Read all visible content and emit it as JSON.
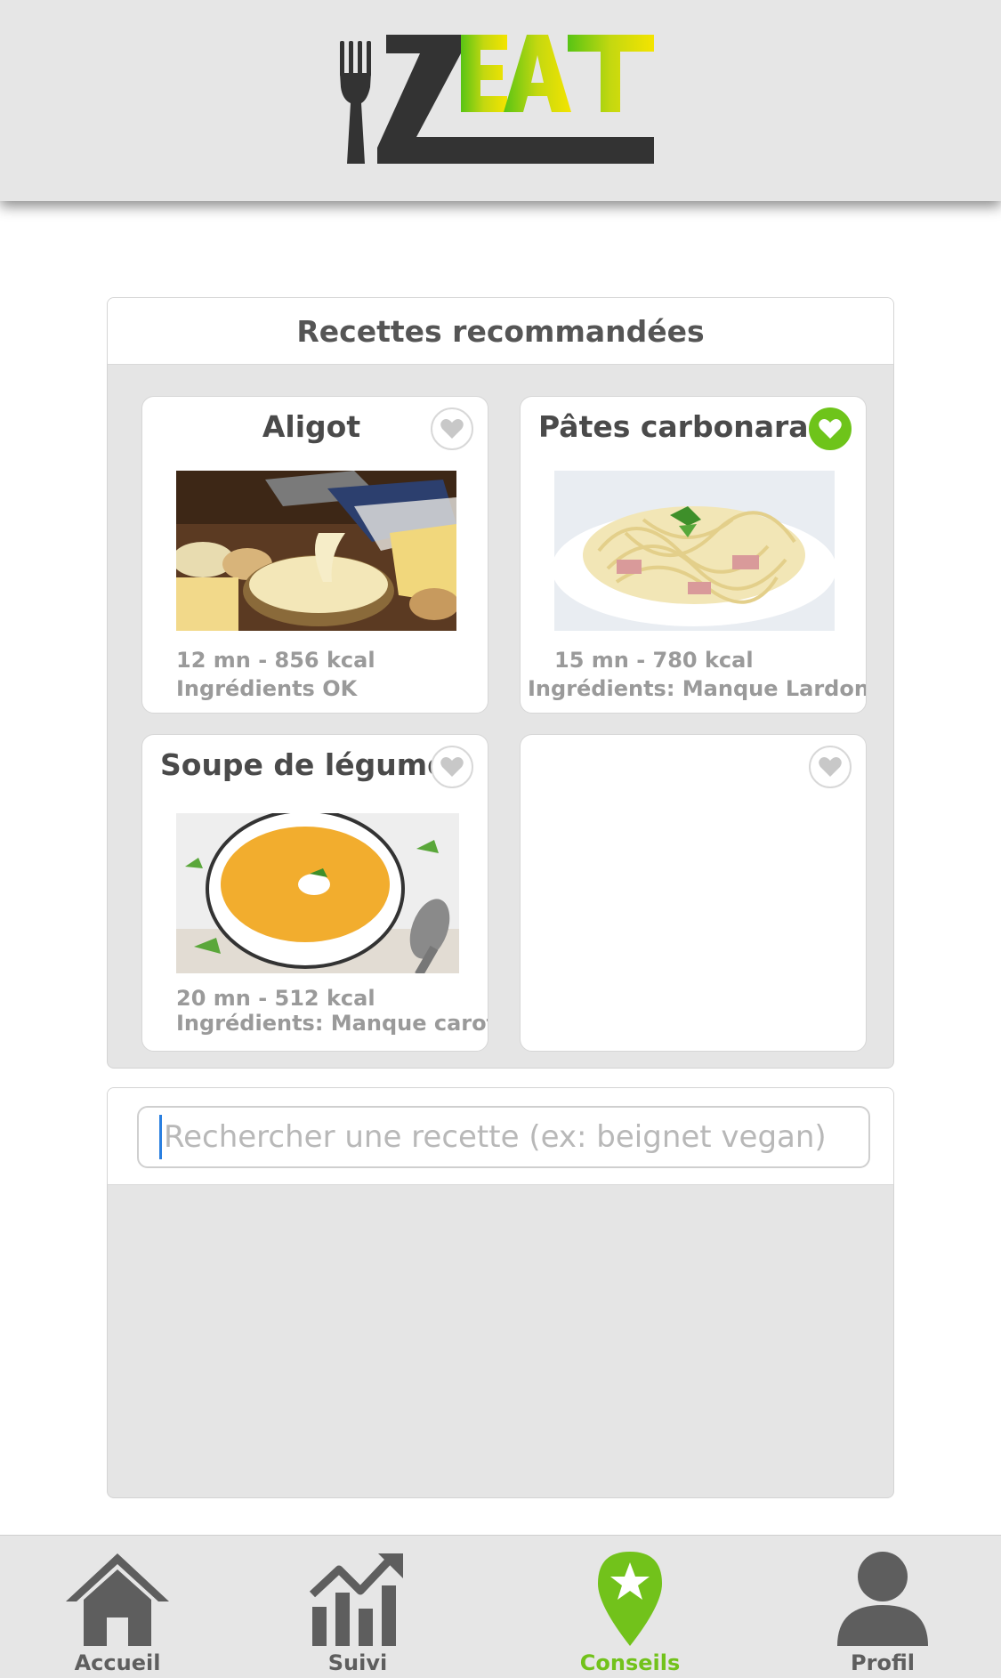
{
  "header": {
    "logo_text": "ZEAT"
  },
  "recommended": {
    "title": "Recettes recommandées",
    "cards": [
      {
        "title": "Aligot",
        "favorite": false,
        "time_kcal": "12 mn - 856 kcal",
        "ingredients": "Ingrédients OK",
        "image": "aligot-photo"
      },
      {
        "title": "Pâtes carbonara",
        "favorite": true,
        "time_kcal": "15 mn - 780 kcal",
        "ingredients": "Ingrédients: Manque Lardons, ...",
        "image": "carbonara-photo"
      },
      {
        "title": "Soupe de légumes",
        "favorite": false,
        "time_kcal": "20 mn - 512 kcal",
        "ingredients": "Ingrédients: Manque carotte",
        "image": "soup-photo"
      },
      {
        "title": "",
        "favorite": false,
        "time_kcal": "",
        "ingredients": ""
      }
    ]
  },
  "search": {
    "placeholder": "Rechercher une recette (ex: beignet vegan)",
    "value": ""
  },
  "nav": {
    "items": [
      {
        "label": "Accueil",
        "icon": "home-icon",
        "active": false
      },
      {
        "label": "Suivi",
        "icon": "chart-icon",
        "active": false
      },
      {
        "label": "Conseils",
        "icon": "map-pin-star-icon",
        "active": true
      },
      {
        "label": "Profil",
        "icon": "user-icon",
        "active": false
      }
    ]
  },
  "colors": {
    "accent_green": "#6ec41a",
    "nav_active": "#72c21b",
    "logo_dark": "#333333",
    "logo_yellow": "#f2e600"
  }
}
